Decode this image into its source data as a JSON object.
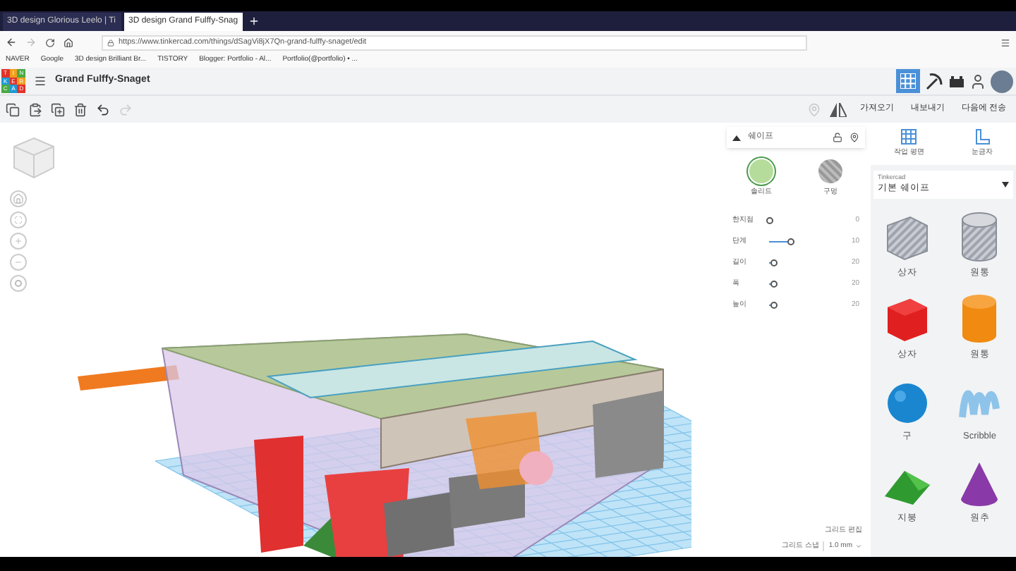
{
  "browser": {
    "tabs": [
      {
        "title": "3D design Glorious Leelo | Ti",
        "selected": false
      },
      {
        "title": "3D design Grand Fulffy-Snag",
        "selected": true
      }
    ],
    "url": "https://www.tinkercad.com/things/dSagVi8jX7Qn-grand-fulffy-snaget/edit",
    "bookmarks": [
      "NAVER",
      "Google",
      "3D design Brilliant Br...",
      "TISTORY",
      "Blogger: Portfolio - Al...",
      "Portfolio(@portfolio) • ..."
    ]
  },
  "app": {
    "logo": [
      "T",
      "I",
      "N",
      "K",
      "E",
      "R",
      "C",
      "A",
      "D"
    ],
    "title": "Grand Fulffy-Snaget",
    "actions": [
      "가져오기",
      "내보내기",
      "다음에 전송"
    ]
  },
  "shape_panel": {
    "title": "쉐이프",
    "modes": [
      {
        "label": "솔리드",
        "selected": true
      },
      {
        "label": "구멍",
        "selected": false
      }
    ],
    "params": [
      {
        "label": "한지점",
        "value": "0",
        "level": 0.0
      },
      {
        "label": "단계",
        "value": "10",
        "level": 0.3
      },
      {
        "label": "길이",
        "value": "20",
        "level": 0.05
      },
      {
        "label": "폭",
        "value": "20",
        "level": 0.05
      },
      {
        "label": "높이",
        "value": "20",
        "level": 0.05
      }
    ]
  },
  "library": {
    "tools": [
      "작업 평면",
      "눈금자"
    ],
    "source": "Tinkercad",
    "category": "기본 쉐이프",
    "shapes": [
      {
        "label": "상자",
        "kind": "stripebox"
      },
      {
        "label": "원통",
        "kind": "stripecyl"
      },
      {
        "label": "상자",
        "kind": "box"
      },
      {
        "label": "원통",
        "kind": "cylinder"
      },
      {
        "label": "구",
        "kind": "sphere"
      },
      {
        "label": "Scribble",
        "kind": "scribble"
      },
      {
        "label": "지붕",
        "kind": "roof"
      },
      {
        "label": "원추",
        "kind": "cone"
      }
    ]
  },
  "grid": {
    "edit": "그리드 편집",
    "snap_label": "그리드 스냅",
    "snap_value": "1.0 mm"
  }
}
